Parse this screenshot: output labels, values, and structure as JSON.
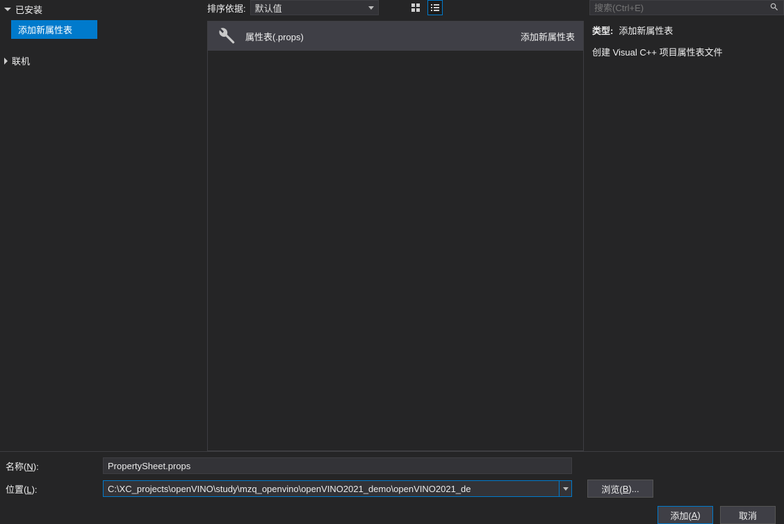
{
  "sidebar": {
    "installed_label": "已安装",
    "items": [
      {
        "label": "添加新属性表"
      }
    ],
    "online_label": "联机"
  },
  "toolbar": {
    "sort_label": "排序依据:",
    "sort_value": "默认值"
  },
  "list": {
    "items": [
      {
        "name": "属性表(.props)",
        "badge": "添加新属性表"
      }
    ]
  },
  "search": {
    "placeholder": "搜索(Ctrl+E)"
  },
  "details": {
    "type_label": "类型:",
    "type_value": "添加新属性表",
    "description": "创建 Visual C++ 项目属性表文件"
  },
  "form": {
    "name_label_pre": "名称(",
    "name_label_key": "N",
    "name_label_post": "):",
    "name_value": "PropertySheet.props",
    "location_label_pre": "位置(",
    "location_label_key": "L",
    "location_label_post": "):",
    "location_value": "C:\\XC_projects\\openVINO\\study\\mzq_openvino\\openVINO2021_demo\\openVINO2021_de",
    "browse_pre": "浏览(",
    "browse_key": "B",
    "browse_post": ")..."
  },
  "buttons": {
    "add_pre": "添加(",
    "add_key": "A",
    "add_post": ")",
    "cancel": "取消"
  }
}
